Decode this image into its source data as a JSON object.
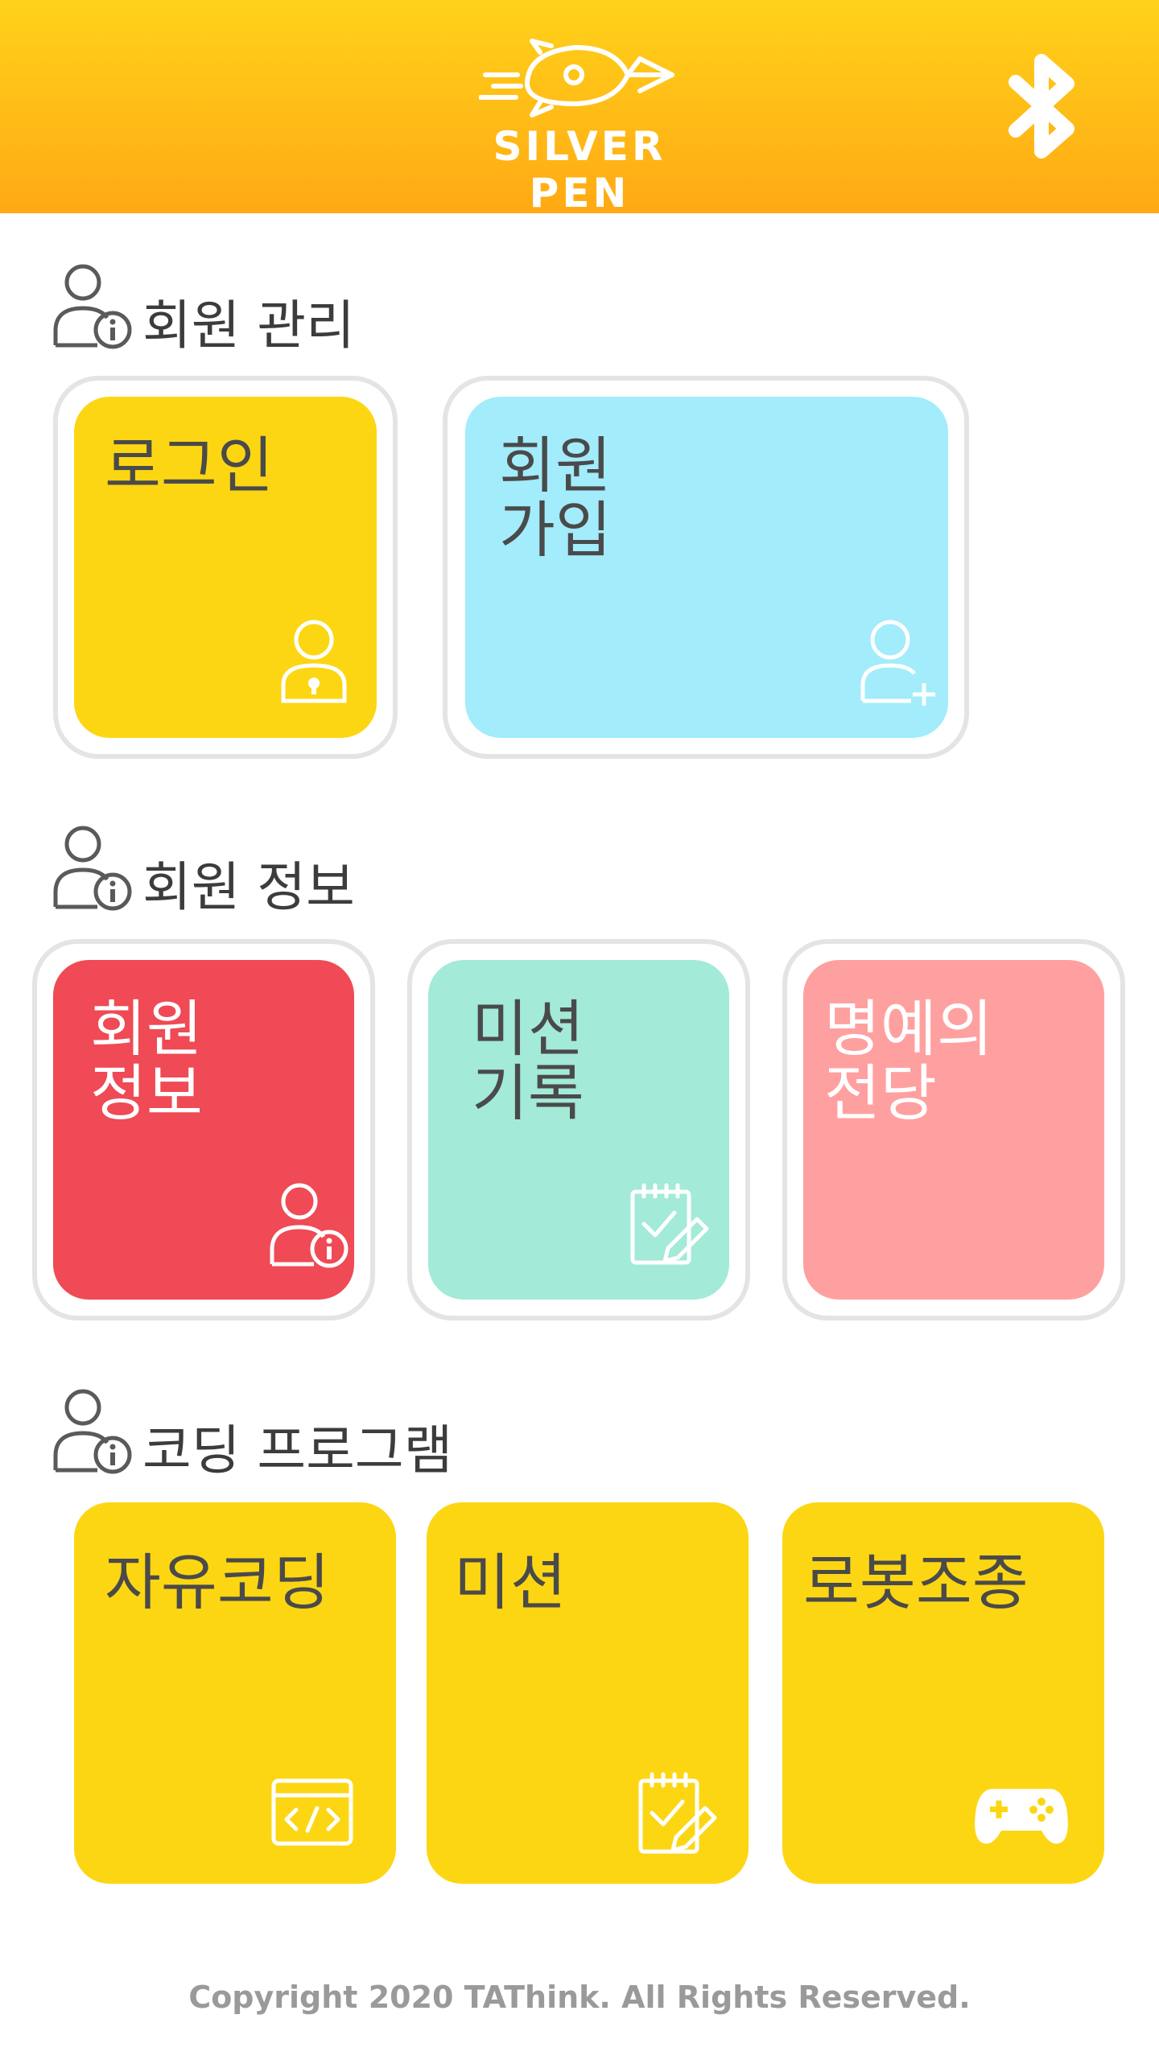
{
  "header": {
    "logo_text": "SILVER PEN",
    "logo_icon": "rocket-pen-logo",
    "bluetooth_icon": "bluetooth-icon",
    "gradient_colors": [
      "#FFD21A",
      "#FFA914"
    ]
  },
  "sections": {
    "member_management": {
      "title": "회원 관리",
      "icon": "user-info-icon"
    },
    "member_info": {
      "title": "회원 정보",
      "icon": "user-info-icon"
    },
    "coding_program": {
      "title": "코딩 프로그램",
      "icon": "user-info-icon"
    }
  },
  "tiles": {
    "login": {
      "label": "로그인",
      "icon": "user-lock-icon",
      "color": "#FCD612"
    },
    "signup": {
      "label": "회원\n가입",
      "icon": "user-add-icon",
      "color": "#A2ECFB"
    },
    "member_info": {
      "label": "회원\n정보",
      "icon": "user-info-icon",
      "color": "#EF4A55"
    },
    "mission_record": {
      "label": "미션\n기록",
      "icon": "checklist-icon",
      "color": "#A3EAD8"
    },
    "hall_of_fame": {
      "label": "명예의\n전당",
      "icon": "",
      "color": "#FFA0A0"
    },
    "free_coding": {
      "label": "자유코딩",
      "icon": "code-window-icon",
      "color": "#FCD612"
    },
    "mission": {
      "label": "미션",
      "icon": "checklist-icon",
      "color": "#FCD612"
    },
    "robot_control": {
      "label": "로봇조종",
      "icon": "gamepad-icon",
      "color": "#FCD612"
    }
  },
  "footer": {
    "copyright": "Copyright 2020 TAThink. All Rights Reserved."
  }
}
